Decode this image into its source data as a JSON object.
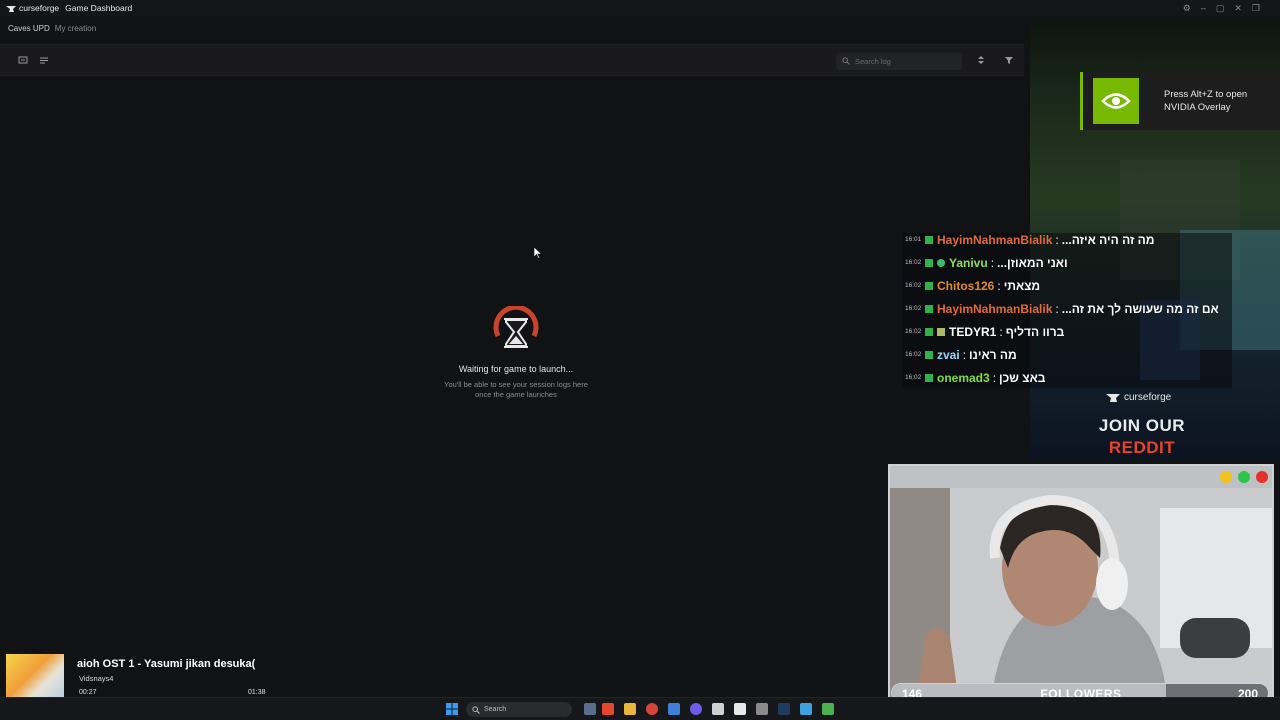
{
  "app": {
    "brand": "curseforge",
    "window_title": "Game Dashboard",
    "breadcrumb": {
      "current": "Caves UPD",
      "link": "My creation"
    },
    "search": {
      "placeholder": "Search log"
    },
    "waiting": {
      "title": "Waiting for game to launch...",
      "line1": "You'll be able to see your session logs here",
      "line2": "once the game launches"
    }
  },
  "overlay": {
    "nvidia": {
      "line1": "Press Alt+Z to open",
      "line2": "NVIDIA Overlay"
    },
    "chat": [
      {
        "time": "16:01",
        "user": "HayimNahmanBialik",
        "msg": "...מה זה היה איזה",
        "color": "#e06a3a"
      },
      {
        "time": "16:02",
        "user": "Yanivu",
        "msg": "...ואני המאוזן",
        "color": "#8fdc5a"
      },
      {
        "time": "16:02",
        "user": "Chitos126",
        "msg": "מצאתי",
        "color": "#e08a2a"
      },
      {
        "time": "16:02",
        "user": "HayimNahmanBialik",
        "msg": "...אם זה מה שעושה לך את זה",
        "color": "#e06a3a"
      },
      {
        "time": "16:02",
        "user": "TEDYR1",
        "msg": "ברוו הדליף",
        "color": "#ffffff"
      },
      {
        "time": "16:02",
        "user": "zvai",
        "msg": "מה ראינו",
        "color": "#9ad6ff"
      },
      {
        "time": "16:02",
        "user": "onemad3",
        "msg": "באצ שכן",
        "color": "#7ddf3c"
      }
    ],
    "cf_brand": "curseforge",
    "reddit": {
      "join": "JOIN OUR",
      "word": "REDDIT"
    },
    "followers": {
      "current": "146",
      "label": "FOLLOWERS",
      "goal": "200",
      "progress": 0.73
    },
    "music": {
      "title": "aioh OST 1 - Yasumi jikan desuka(",
      "artist": "Vidsnays4",
      "elapsed": "00:27",
      "duration": "01:38",
      "progress": 0.28
    }
  },
  "taskbar": {
    "search_label": "Search"
  },
  "colors": {
    "accent": "#e8432a",
    "nvidia_green": "#76b900"
  }
}
